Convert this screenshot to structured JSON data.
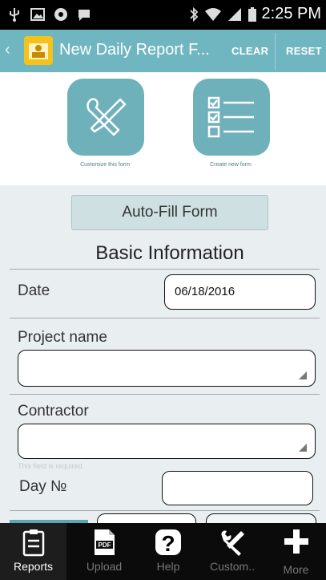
{
  "status_bar": {
    "time": "2:25 PM"
  },
  "action_bar": {
    "title": "New Daily Report F...",
    "clear_label": "CLEAR",
    "reset_label": "RESET"
  },
  "tiles": {
    "customize_caption": "Customize this form",
    "create_caption": "Create new form"
  },
  "form": {
    "autofill_label": "Auto-Fill Form",
    "section_title": "Basic Information",
    "date_label": "Date",
    "date_value": "06/18/2016",
    "project_label": "Project name",
    "project_value": "",
    "contractor_label": "Contractor",
    "contractor_value": "",
    "required_hint": "This field is required",
    "day_label": "Day №",
    "day_value": ""
  },
  "bottom_nav": {
    "items": [
      {
        "label": "Reports",
        "icon": "clipboard-icon",
        "active": true
      },
      {
        "label": "Upload",
        "icon": "pdf-icon",
        "active": false
      },
      {
        "label": "Help",
        "icon": "help-icon",
        "active": false
      },
      {
        "label": "Custom..",
        "icon": "tools-icon",
        "active": false
      },
      {
        "label": "More",
        "icon": "plus-icon",
        "active": false
      }
    ]
  },
  "colors": {
    "action_bar": "#6fb6c1",
    "tile": "#6fb1ba",
    "nav_bg": "#0b0b0b"
  }
}
